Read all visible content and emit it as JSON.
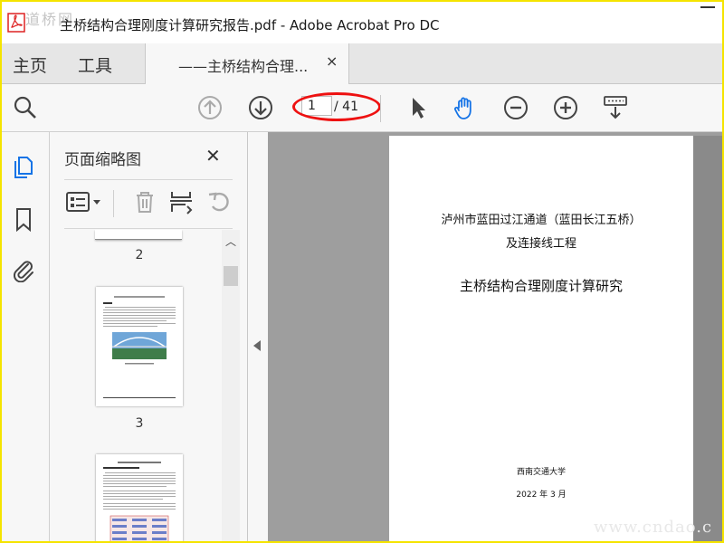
{
  "window": {
    "title": "主桥结构合理刚度计算研究报告.pdf - Adobe Acrobat Pro DC",
    "watermark_top_left": "道桥网",
    "watermark_bottom_right": "www.cndao.c"
  },
  "tabs": {
    "home": "主页",
    "tools": "工具",
    "document": "——主桥结构合理...",
    "close": "×"
  },
  "toolbar": {
    "page_current": "1",
    "page_total": "/ 41",
    "icons": [
      "search-zoom-icon",
      "page-up-icon",
      "page-down-icon",
      "select-arrow-icon",
      "hand-icon",
      "zoom-out-icon",
      "zoom-in-icon",
      "keyboard-icon"
    ]
  },
  "sidebar": {
    "icons": [
      "pages-icon",
      "bookmark-icon",
      "attachment-icon"
    ]
  },
  "thumbnails_panel": {
    "title": "页面缩略图",
    "close": "✕",
    "pages": [
      {
        "number": "2"
      },
      {
        "number": "3"
      }
    ]
  },
  "document": {
    "line1": "泸州市蓝田过江通道（蓝田长江五桥）",
    "line2": "及连接线工程",
    "line3": "主桥结构合理刚度计算研究",
    "institution": "西南交通大学",
    "date": "2022 年 3 月"
  },
  "colors": {
    "accent_blue": "#1473e6",
    "highlight_red": "#e11111",
    "frame_yellow": "#f5e400"
  }
}
